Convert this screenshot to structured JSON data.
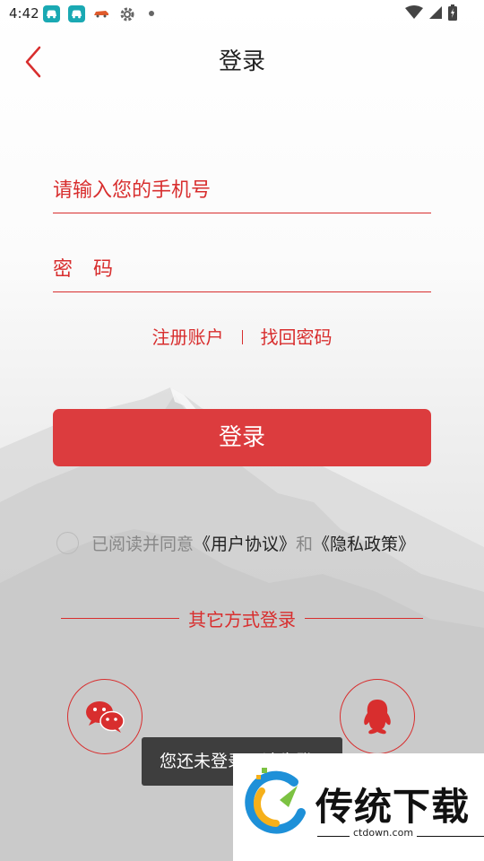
{
  "status_bar": {
    "time": "4:42"
  },
  "header": {
    "title": "登录"
  },
  "form": {
    "phone_placeholder": "请输入您的手机号",
    "password_placeholder": "密 码",
    "register_label": "注册账户",
    "forgot_label": "找回密码",
    "login_label": "登录"
  },
  "agreement": {
    "prefix": "已阅读并同意",
    "user_agreement": "《用户协议》",
    "conjunction": "和",
    "privacy_policy": "《隐私政策》"
  },
  "other_login": {
    "label": "其它方式登录"
  },
  "toast": {
    "text": "您还未登录，请先登录"
  },
  "watermark": {
    "title": "传统下载",
    "url": "ctdown.com"
  },
  "colors": {
    "accent": "#d82e2e",
    "button": "#dc3c3e"
  },
  "icons": [
    "back-icon",
    "wechat-icon",
    "qq-icon",
    "wifi-icon",
    "signal-icon",
    "battery-icon",
    "gear-icon"
  ]
}
